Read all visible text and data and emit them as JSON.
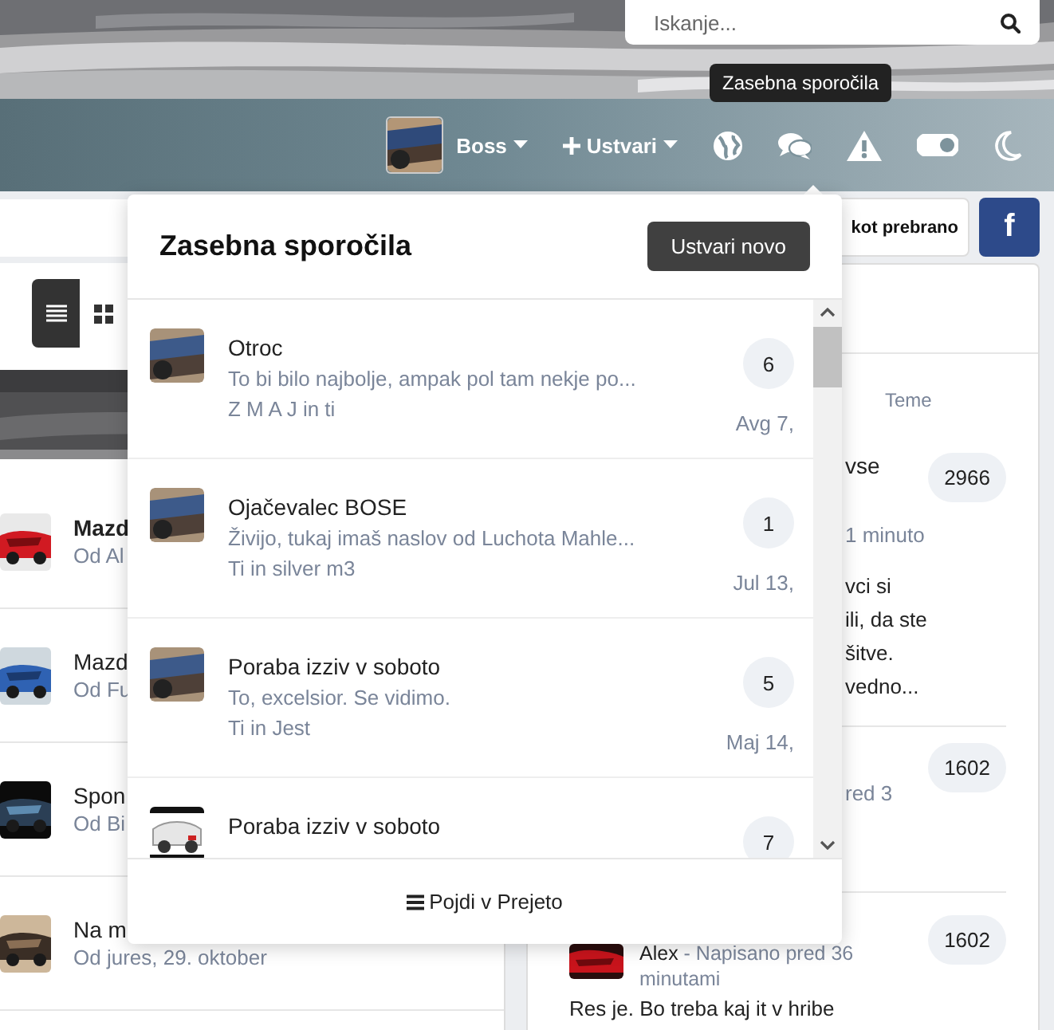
{
  "search": {
    "placeholder": "Iskanje..."
  },
  "tooltip": "Zasebna sporočila",
  "nav": {
    "user": "Boss",
    "create": "Ustvari",
    "theme_toggle": {
      "on": true
    }
  },
  "toolbar": {
    "mark_read": "kot prebrano",
    "facebook": "f"
  },
  "view_modes": [
    {
      "kind": "list",
      "selected": true
    },
    {
      "kind": "grid",
      "selected": false
    }
  ],
  "threads": [
    {
      "title": "Mazd",
      "meta": "Od Al",
      "unread": true
    },
    {
      "title": "Mazd",
      "meta": "Od Fu",
      "unread": false
    },
    {
      "title": "Spon",
      "meta": "Od Bi",
      "unread": false
    },
    {
      "title": "Na m",
      "meta": "Od jures, 29. oktober",
      "unread": false
    }
  ],
  "forum": {
    "column": "Teme",
    "rows": [
      {
        "title": "vse",
        "count": "2966",
        "meta": "1 minuto",
        "excerpt": [
          "vci si",
          "ili, da ste",
          "šitve.",
          "vedno..."
        ]
      },
      {
        "count": "1602",
        "meta": "red 3"
      },
      {
        "count": "1602",
        "author": "Alex",
        "meta": "- Napisano pred 36 minutami",
        "excerpt": [
          "Res je. Bo treba kaj it v hribe"
        ]
      }
    ]
  },
  "messages": {
    "title": "Zasebna sporočila",
    "new_button": "Ustvari novo",
    "conversations": [
      {
        "title": "Otroc",
        "preview": "To bi bilo najbolje, ampak pol tam nekje po...",
        "participants": "Z M A J in ti",
        "count": "6",
        "date": "Avg 7,"
      },
      {
        "title": "Ojačevalec BOSE",
        "preview": "Živijo, tukaj imaš naslov od Luchota   Mahle...",
        "participants": "Ti in silver m3",
        "count": "1",
        "date": "Jul 13,"
      },
      {
        "title": "Poraba izziv v soboto",
        "preview": "To, excelsior. Se vidimo.",
        "participants": "Ti in Jest",
        "count": "5",
        "date": "Maj 14,"
      },
      {
        "title": "Poraba izziv v soboto",
        "count": "7"
      }
    ],
    "footer": "Pojdi v Prejeto"
  }
}
